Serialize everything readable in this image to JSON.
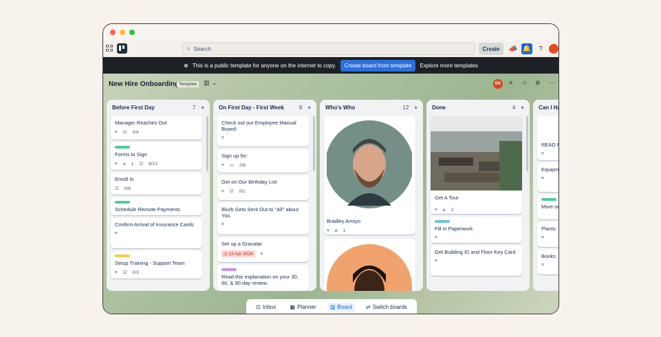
{
  "topbar": {
    "search_placeholder": "Search",
    "create_label": "Create"
  },
  "banner": {
    "text": "This is a public template for anyone on the internet to copy.",
    "create_btn": "Create board from template",
    "explore": "Explore more templates"
  },
  "board": {
    "name": "New Hire Onboarding",
    "template_badge": "Template",
    "member_initials": "EK"
  },
  "lists": [
    {
      "title": "Before First Day",
      "count": "7",
      "cards": [
        {
          "title": "Manager Reaches Out",
          "checklist": "0/4"
        },
        {
          "title": "Forms to Sign",
          "attachments": "1",
          "checklist": "8/13"
        },
        {
          "title": "Enroll In",
          "checklist": "0/8"
        },
        {
          "title": "Schedule Remote Payments"
        },
        {
          "title": "Confirm Arrival of Insurance Cards"
        },
        {
          "title": "Setup Training - Support Team",
          "checklist": "0/3"
        }
      ]
    },
    {
      "title": "On First Day - First Week",
      "count": "9",
      "cards": [
        {
          "title": "Check out our Employee Manual Board!"
        },
        {
          "title": "Sign up for:",
          "comments": "2/8"
        },
        {
          "title": "Get on Our Birthday List",
          "checklist": "0/1"
        },
        {
          "title": "Blurb Gets Sent Out to \"All\" about You"
        },
        {
          "title": "Set up a Gravatar",
          "due": "23 Apr 2024"
        },
        {
          "title": "Read this explanation on your 30, 60, & 90 day review."
        }
      ]
    },
    {
      "title": "Who's Who",
      "count": "12",
      "cards": [
        {
          "title": "Bradley Arroyo",
          "attachments": "1"
        }
      ]
    },
    {
      "title": "Done",
      "count": "4",
      "cards": [
        {
          "title": "Get A Tour",
          "attachments": "2"
        },
        {
          "title": "Fill in Paperwork"
        },
        {
          "title": "Get Building ID and Floor Key Card"
        }
      ]
    },
    {
      "title": "Can I Ha",
      "cards": [
        {
          "title": "READ M"
        },
        {
          "title": "Equipme / Softwa"
        },
        {
          "title": "More on"
        },
        {
          "title": "Plants"
        },
        {
          "title": "Books"
        }
      ]
    }
  ],
  "bottom_nav": [
    {
      "label": "Inbox"
    },
    {
      "label": "Planner"
    },
    {
      "label": "Board"
    },
    {
      "label": "Switch boards"
    }
  ],
  "colors": {
    "green_label": "#4bce97",
    "yellow_label": "#f5cd47",
    "purple_label": "#c68ff0",
    "blue_label": "#6cc3e0",
    "accent": "#1868db"
  }
}
